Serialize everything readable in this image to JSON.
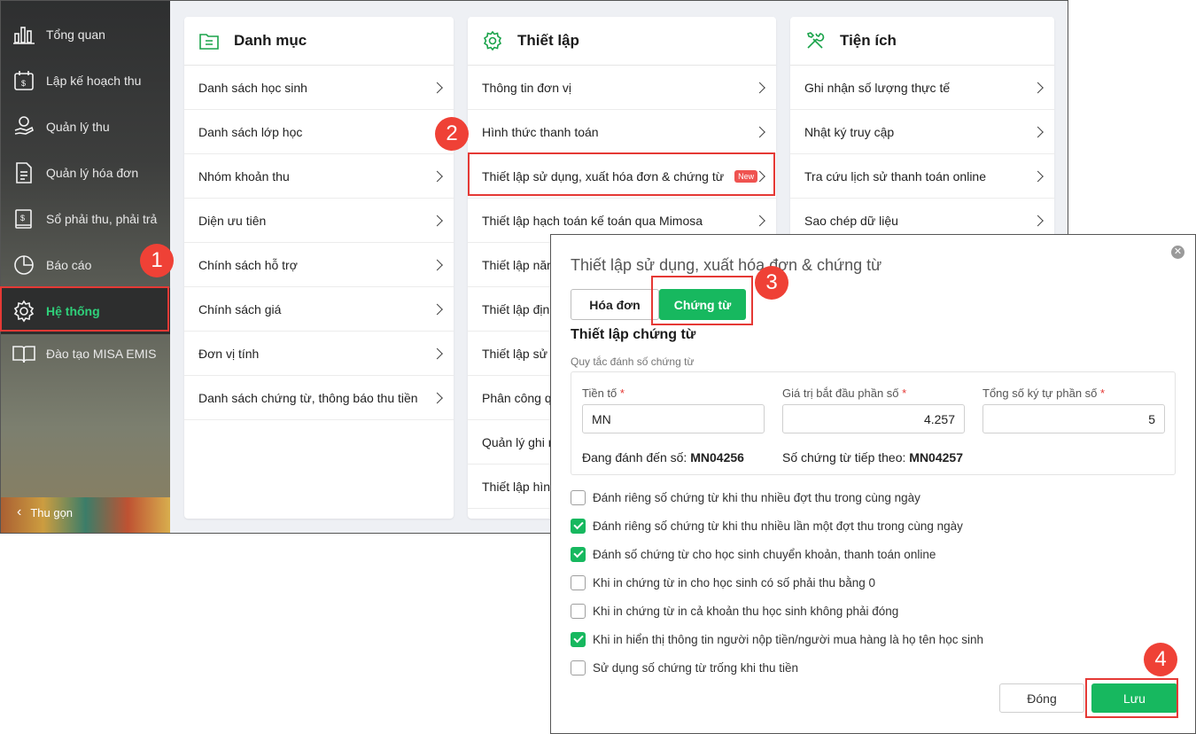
{
  "sidebar": {
    "items": [
      {
        "label": "Tổng quan",
        "icon": "chart-bars-icon"
      },
      {
        "label": "Lập kế hoạch thu",
        "icon": "calendar-money-icon"
      },
      {
        "label": "Quản lý thu",
        "icon": "hand-coin-icon"
      },
      {
        "label": "Quản lý hóa đơn",
        "icon": "invoice-icon"
      },
      {
        "label": "Sổ phải thu, phải trả",
        "icon": "ledger-icon"
      },
      {
        "label": "Báo cáo",
        "icon": "pie-chart-icon"
      },
      {
        "label": "Hệ thống",
        "icon": "gear-icon",
        "active": true
      },
      {
        "label": "Đào tạo MISA EMIS",
        "icon": "open-book-icon"
      }
    ],
    "collapse_label": "Thu gọn"
  },
  "cards": {
    "catalog": {
      "title": "Danh mục",
      "items": [
        "Danh sách học sinh",
        "Danh sách lớp học",
        "Nhóm khoản thu",
        "Diện ưu tiên",
        "Chính sách hỗ trợ",
        "Chính sách giá",
        "Đơn vị tính",
        "Danh sách chứng từ, thông báo thu tiền"
      ]
    },
    "settings": {
      "title": "Thiết lập",
      "items": [
        "Thông tin đơn vị",
        "Hình thức thanh toán",
        "Thiết lập sử dụng, xuất hóa đơn & chứng từ",
        "Thiết lập hạch toán kế toán qua Mimosa",
        "Thiết lập năm",
        "Thiết lập định",
        "Thiết lập sử c",
        "Phân công q",
        "Quản lý ghi n",
        "Thiết lập hình"
      ],
      "new_badge": "New"
    },
    "utilities": {
      "title": "Tiện ích",
      "items": [
        "Ghi nhận số lượng thực tế",
        "Nhật ký truy cập",
        "Tra cứu lịch sử thanh toán online",
        "Sao chép dữ liệu"
      ]
    }
  },
  "markers": [
    "1",
    "2",
    "3",
    "4"
  ],
  "modal": {
    "title": "Thiết lập sử dụng, xuất hóa đơn & chứng từ",
    "close_glyph": "✕",
    "tabs": [
      "Hóa đơn",
      "Chứng từ"
    ],
    "active_tab": "Chứng từ",
    "section_title": "Thiết lập chứng từ",
    "rule_label": "Quy tắc đánh số chứng từ",
    "fields": {
      "prefix": {
        "label": "Tiền tố",
        "value": "MN"
      },
      "start": {
        "label": "Giá trị bắt đầu phần số",
        "value": "4.257"
      },
      "digits": {
        "label": "Tổng số ký tự phần số",
        "value": "5"
      },
      "required_mark": "*"
    },
    "current_label": "Đang đánh đến số:",
    "current_value": "MN04256",
    "next_label": "Số chứng từ tiếp theo:",
    "next_value": "MN04257",
    "options": [
      {
        "label": "Đánh riêng số chứng từ khi thu nhiều đợt thu trong cùng ngày",
        "checked": false
      },
      {
        "label": "Đánh riêng số chứng từ khi thu nhiều lần một đợt thu trong cùng ngày",
        "checked": true
      },
      {
        "label": "Đánh số chứng từ cho học sinh chuyển khoản, thanh toán online",
        "checked": true
      },
      {
        "label": "Khi in chứng từ in cho học sinh có số phải thu bằng 0",
        "checked": false
      },
      {
        "label": "Khi in chứng từ in cả khoản thu học sinh không phải đóng",
        "checked": false
      },
      {
        "label": "Khi in hiển thị thông tin người nộp tiền/người mua hàng là họ tên học sinh",
        "checked": true
      },
      {
        "label": "Sử dụng số chứng từ trống khi thu tiền",
        "checked": false
      }
    ],
    "buttons": {
      "close": "Đóng",
      "save": "Lưu"
    }
  },
  "colors": {
    "accent": "#17b85f",
    "marker": "#ef4136",
    "highlight": "#e53935"
  }
}
